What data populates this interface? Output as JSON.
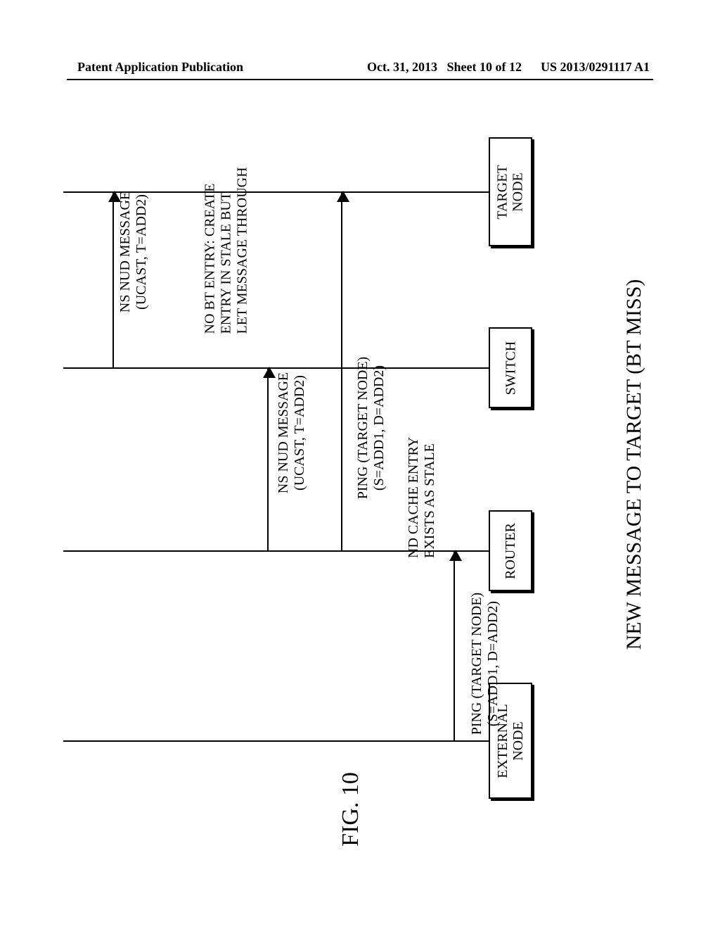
{
  "header": {
    "left": "Patent Application Publication",
    "date": "Oct. 31, 2013",
    "sheet": "Sheet 10 of 12",
    "pubnum": "US 2013/0291117 A1"
  },
  "diagram": {
    "title": "NEW MESSAGE TO TARGET (BT MISS)",
    "figure": "FIG. 10",
    "entities": {
      "external_node": "EXTERNAL\nNODE",
      "router": "ROUTER",
      "switch": "SWITCH",
      "target_node": "TARGET\nNODE"
    },
    "messages": {
      "m1_l1": "PING (TARGET NODE)",
      "m1_l2": "(S=ADD1, D=ADD2)",
      "note1_l1": "ND CACHE ENTRY",
      "note1_l2": "EXISTS AS STALE",
      "m2_l1": "PING (TARGET NODE)",
      "m2_l2": "(S=ADD1, D=ADD2)",
      "m3_l1": "NS NUD MESSAGE",
      "m3_l2": "(UCAST, T=ADD2)",
      "note2_l1": "NO BT ENTRY: CREATE",
      "note2_l2": "ENTRY IN STALE BUT",
      "note2_l3": "LET MESSAGE THROUGH",
      "m4_l1": "NS NUD MESSAGE",
      "m4_l2": "(UCAST, T=ADD2)"
    }
  },
  "chart_data": {
    "type": "sequence",
    "title": "NEW MESSAGE TO TARGET (BT MISS)",
    "participants": [
      "EXTERNAL NODE",
      "ROUTER",
      "SWITCH",
      "TARGET NODE"
    ],
    "events": [
      {
        "from": "EXTERNAL NODE",
        "to": "ROUTER",
        "label": "PING (TARGET NODE) (S=ADD1, D=ADD2)"
      },
      {
        "at": "ROUTER",
        "note": "ND CACHE ENTRY EXISTS AS STALE"
      },
      {
        "from": "ROUTER",
        "to": "TARGET NODE",
        "label": "PING (TARGET NODE) (S=ADD1, D=ADD2)"
      },
      {
        "from": "ROUTER",
        "to": "SWITCH",
        "label": "NS NUD MESSAGE (UCAST, T=ADD2)"
      },
      {
        "at": "SWITCH",
        "note": "NO BT ENTRY: CREATE ENTRY IN STALE BUT LET MESSAGE THROUGH"
      },
      {
        "from": "SWITCH",
        "to": "TARGET NODE",
        "label": "NS NUD MESSAGE (UCAST, T=ADD2)"
      }
    ],
    "figure": "FIG. 10"
  }
}
